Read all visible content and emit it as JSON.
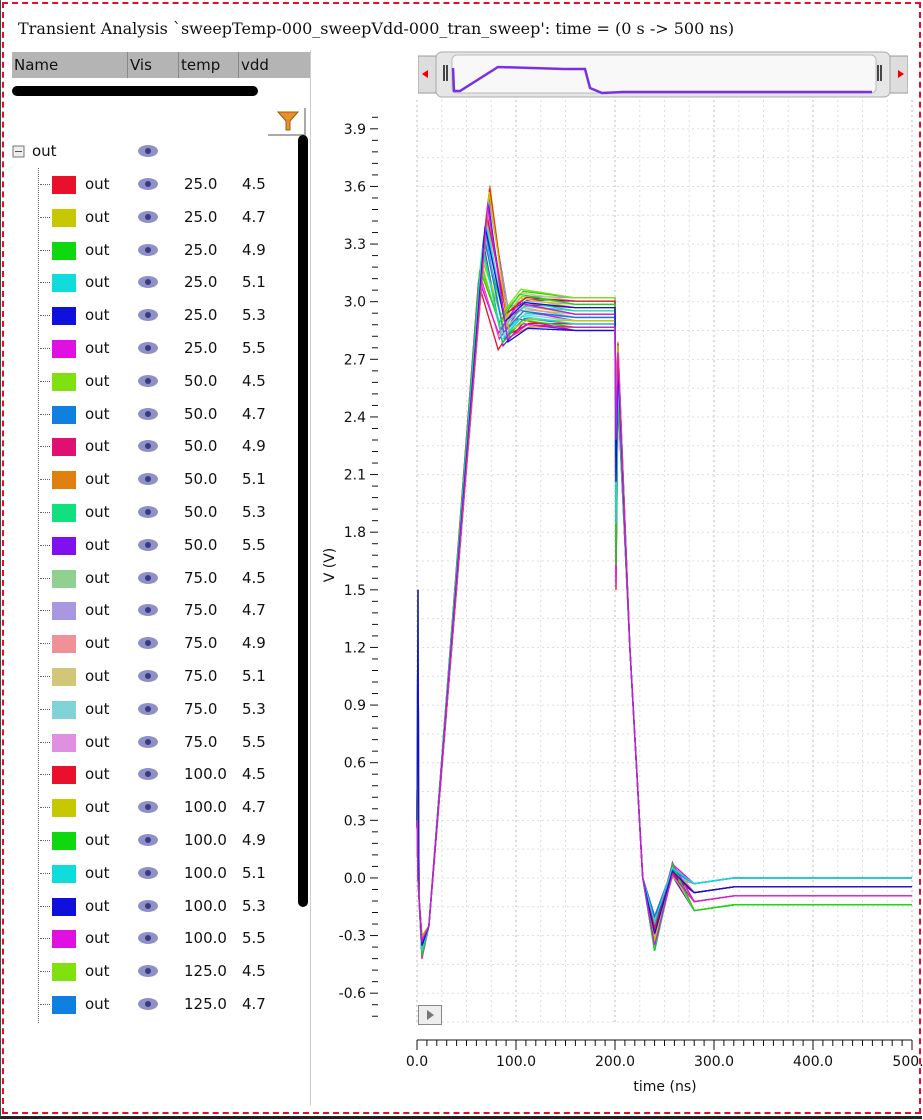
{
  "window": {
    "title": "Transient Analysis `sweepTemp-000_sweepVdd-000_tran_sweep': time = (0 s -> 500 ns)"
  },
  "table": {
    "columns": [
      "Name",
      "Vis",
      "temp",
      "vdd"
    ],
    "root": {
      "name": "out",
      "icon": "eye-icon"
    },
    "rows": [
      {
        "name": "out",
        "temp": "25.0",
        "vdd": "4.5",
        "color": "#e8102a"
      },
      {
        "name": "out",
        "temp": "25.0",
        "vdd": "4.7",
        "color": "#c8c800"
      },
      {
        "name": "out",
        "temp": "25.0",
        "vdd": "4.9",
        "color": "#10d810"
      },
      {
        "name": "out",
        "temp": "25.0",
        "vdd": "5.1",
        "color": "#10dcdc"
      },
      {
        "name": "out",
        "temp": "25.0",
        "vdd": "5.3",
        "color": "#1010dc"
      },
      {
        "name": "out",
        "temp": "25.0",
        "vdd": "5.5",
        "color": "#e010e0"
      },
      {
        "name": "out",
        "temp": "50.0",
        "vdd": "4.5",
        "color": "#80e010"
      },
      {
        "name": "out",
        "temp": "50.0",
        "vdd": "4.7",
        "color": "#1080e0"
      },
      {
        "name": "out",
        "temp": "50.0",
        "vdd": "4.9",
        "color": "#e01070"
      },
      {
        "name": "out",
        "temp": "50.0",
        "vdd": "5.1",
        "color": "#e08010"
      },
      {
        "name": "out",
        "temp": "50.0",
        "vdd": "5.3",
        "color": "#10e080"
      },
      {
        "name": "out",
        "temp": "50.0",
        "vdd": "5.5",
        "color": "#8010f0"
      },
      {
        "name": "out",
        "temp": "75.0",
        "vdd": "4.5",
        "color": "#90d090"
      },
      {
        "name": "out",
        "temp": "75.0",
        "vdd": "4.7",
        "color": "#a898e0"
      },
      {
        "name": "out",
        "temp": "75.0",
        "vdd": "4.9",
        "color": "#f09098"
      },
      {
        "name": "out",
        "temp": "75.0",
        "vdd": "5.1",
        "color": "#d0c878"
      },
      {
        "name": "out",
        "temp": "75.0",
        "vdd": "5.3",
        "color": "#80d4d8"
      },
      {
        "name": "out",
        "temp": "75.0",
        "vdd": "5.5",
        "color": "#e090e0"
      },
      {
        "name": "out",
        "temp": "100.0",
        "vdd": "4.5",
        "color": "#e8102a"
      },
      {
        "name": "out",
        "temp": "100.0",
        "vdd": "4.7",
        "color": "#c8c800"
      },
      {
        "name": "out",
        "temp": "100.0",
        "vdd": "4.9",
        "color": "#10d810"
      },
      {
        "name": "out",
        "temp": "100.0",
        "vdd": "5.1",
        "color": "#10dcdc"
      },
      {
        "name": "out",
        "temp": "100.0",
        "vdd": "5.3",
        "color": "#1010dc"
      },
      {
        "name": "out",
        "temp": "100.0",
        "vdd": "5.5",
        "color": "#e010e0"
      },
      {
        "name": "out",
        "temp": "125.0",
        "vdd": "4.5",
        "color": "#80e010"
      },
      {
        "name": "out",
        "temp": "125.0",
        "vdd": "4.7",
        "color": "#1080e0"
      }
    ]
  },
  "chart_data": {
    "type": "line",
    "xlabel": "time (ns)",
    "ylabel": "V (V)",
    "xlim": [
      0,
      500
    ],
    "ylim": [
      -0.75,
      4.05
    ],
    "xticks": [
      "0.0",
      "100.0",
      "200.0",
      "300.0",
      "400.0",
      "500."
    ],
    "xtick_values": [
      0,
      100,
      200,
      300,
      400,
      500
    ],
    "yticks": [
      "3.9",
      "3.6",
      "3.3",
      "3.0",
      "2.7",
      "2.4",
      "2.1",
      "1.8",
      "1.5",
      "1.2",
      "0.9",
      "0.6",
      "0.3",
      "0.0",
      "-0.3",
      "-0.6"
    ],
    "ytick_values": [
      3.9,
      3.6,
      3.3,
      3.0,
      2.7,
      2.4,
      2.1,
      1.8,
      1.5,
      1.2,
      0.9,
      0.6,
      0.3,
      0.0,
      -0.3,
      -0.6
    ],
    "grid": true,
    "waveform_template": {
      "t": [
        0,
        3,
        8,
        15,
        68,
        100,
        140,
        200,
        203,
        215,
        228,
        240,
        258,
        300,
        500
      ],
      "description_points": "start 0, dip, ramp to peak, settle high, fall at 200ns, undershoot, settle low"
    },
    "series_params": {
      "peak_range": [
        3.1,
        3.62
      ],
      "high_settle_range": [
        2.85,
        3.02
      ],
      "low_settle_range": [
        -0.14,
        0.0
      ],
      "undershoot_range": [
        -0.38,
        -0.2
      ]
    }
  }
}
